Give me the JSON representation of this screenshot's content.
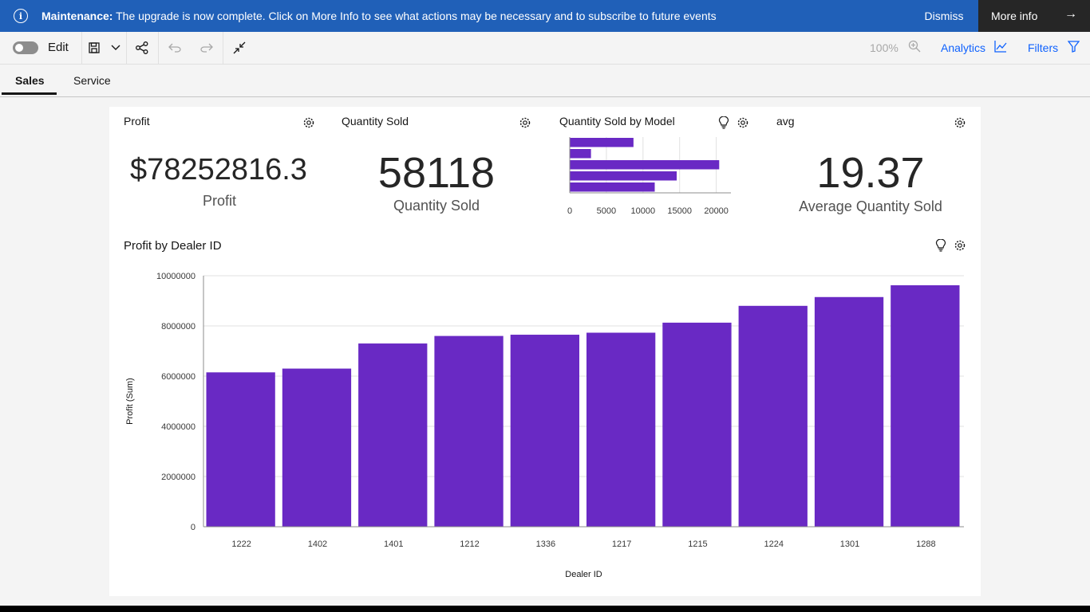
{
  "banner": {
    "title": "Maintenance:",
    "message": "The upgrade is now complete. Click on More Info to see what actions may be necessary and to subscribe to future events",
    "dismiss_label": "Dismiss",
    "more_info_label": "More info"
  },
  "toolbar": {
    "edit_label": "Edit",
    "zoom_label": "100%",
    "analytics_label": "Analytics",
    "filters_label": "Filters"
  },
  "tabs": [
    {
      "label": "Sales",
      "active": true
    },
    {
      "label": "Service",
      "active": false
    }
  ],
  "widgets": {
    "profit": {
      "title": "Profit",
      "value": "$78252816.3",
      "label": "Profit"
    },
    "quantity": {
      "title": "Quantity Sold",
      "value": "58118",
      "label": "Quantity Sold"
    },
    "model": {
      "title": "Quantity Sold by Model"
    },
    "avg": {
      "title": "avg",
      "value": "19.37",
      "label": "Average Quantity Sold"
    },
    "dealer": {
      "title": "Profit by Dealer ID"
    }
  },
  "colors": {
    "bar": "#6929c4",
    "accent": "#0f62fe",
    "banner": "#2060b8"
  },
  "chart_data": [
    {
      "type": "bar",
      "orientation": "horizontal",
      "title": "Quantity Sold by Model",
      "categories": [
        "",
        "",
        "",
        "",
        ""
      ],
      "values": [
        8700,
        2900,
        20400,
        14600,
        11600
      ],
      "xlim": [
        0,
        22000
      ],
      "x_ticks": [
        "0",
        "5000",
        "10000",
        "15000",
        "20000"
      ],
      "grid": true
    },
    {
      "type": "bar",
      "title": "Profit by Dealer ID",
      "xlabel": "Dealer ID",
      "ylabel": "Profit (Sum)",
      "categories": [
        "1222",
        "1402",
        "1401",
        "1212",
        "1336",
        "1217",
        "1215",
        "1224",
        "1301",
        "1288"
      ],
      "values": [
        6150000,
        6300000,
        7300000,
        7600000,
        7650000,
        7730000,
        8130000,
        8800000,
        9150000,
        9620000
      ],
      "ylim": [
        0,
        10000000
      ],
      "y_ticks": [
        "0",
        "2000000",
        "4000000",
        "6000000",
        "8000000",
        "10000000"
      ],
      "grid": true
    }
  ]
}
